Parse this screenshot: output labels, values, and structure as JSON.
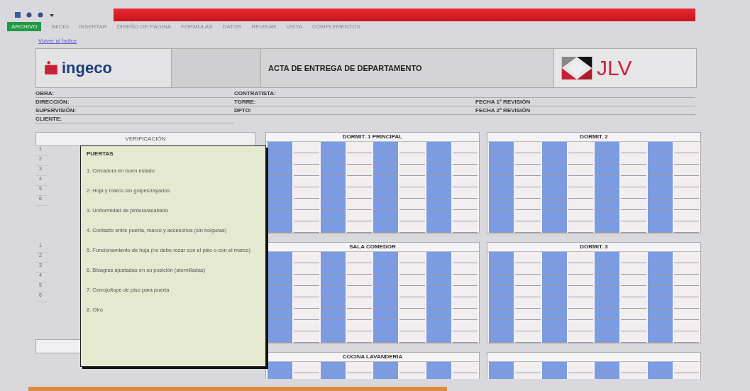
{
  "ribbon": {
    "tabs": [
      {
        "label": "ARCHIVO",
        "kind": "file"
      },
      {
        "label": "INICIO",
        "kind": "tab"
      },
      {
        "label": "INSERTAR",
        "kind": "tab"
      },
      {
        "label": "DISEÑO DE PÁGINA",
        "kind": "tab"
      },
      {
        "label": "FÓRMULAS",
        "kind": "tab"
      },
      {
        "label": "DATOS",
        "kind": "tab"
      },
      {
        "label": "REVISAR",
        "kind": "tab"
      },
      {
        "label": "VISTA",
        "kind": "tab"
      },
      {
        "label": "COMPLEMENTOS",
        "kind": "tab"
      }
    ]
  },
  "link": "Volver al Índice",
  "header": {
    "logo_left": "ingeco",
    "title": "ACTA DE ENTREGA DE DEPARTAMENTO",
    "logo_right": "JLV"
  },
  "info_left": [
    "OBRA:",
    "DIRECCIÓN:",
    "SUPERVISIÓN:",
    "CLIENTE:"
  ],
  "info_mid": [
    "CONTRATISTA:",
    "TORRE:",
    "DPTO:"
  ],
  "info_right": [
    "FECHA 1ª REVISIÓN",
    "FECHA 2ª REVISIÓN"
  ],
  "verification": {
    "heading": "VERIFICACIÓN",
    "sections": [
      [
        "1",
        "2",
        "3",
        "4",
        "5",
        "6"
      ],
      [
        "1",
        "2",
        "3",
        "4",
        "5",
        "6"
      ]
    ]
  },
  "rooms": [
    {
      "kind": "grid",
      "title": "DORMIT. 1 PRINCIPAL"
    },
    {
      "kind": "grid",
      "title": "DORMIT. 2"
    },
    {
      "kind": "grid",
      "title": "SALA COMEDOR"
    },
    {
      "kind": "grid",
      "title": "DORMIT. 3"
    },
    {
      "kind": "grid",
      "title": "COCINA LAVANDERIA"
    },
    {
      "kind": "grid"
    }
  ],
  "comment": {
    "title": "PUERTAS",
    "lines": [
      "1. Cerradura en buen estado",
      "2. Hoja y marco sin golpes/rayados",
      "3. Uniformidad de pintura/acabado",
      "4. Contacto entre puerta, marco y accesorios (sin holguras)",
      "5. Funcionamiento de hoja (no debe rozar con el piso o con el marco)",
      "6. Bisagras ajustadas en su posición (atornilladas)",
      "7. Cerrojo/tope de piso para puerta",
      "8. Otro"
    ]
  }
}
